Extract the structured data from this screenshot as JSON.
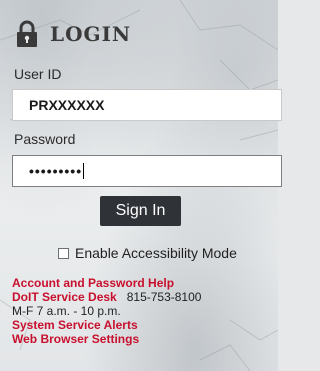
{
  "login": {
    "title": "LOGIN",
    "user_id_label": "User ID",
    "user_id_value": "PRXXXXXX",
    "password_label": "Password",
    "password_value": "•••••••••",
    "sign_in_label": "Sign In",
    "accessibility_label": "Enable Accessibility Mode",
    "accessibility_checked": false
  },
  "links": {
    "account_help": "Account and Password Help",
    "service_desk": "DoIT Service Desk",
    "service_desk_phone": "815-753-8100",
    "hours": "M-F 7 a.m. - 10 p.m.",
    "system_alerts": "System Service Alerts",
    "browser_settings": "Web Browser Settings"
  },
  "colors": {
    "link_red": "#c8102e",
    "button_dark": "#2f3236"
  },
  "icons": {
    "header_icon": "lock-icon"
  }
}
